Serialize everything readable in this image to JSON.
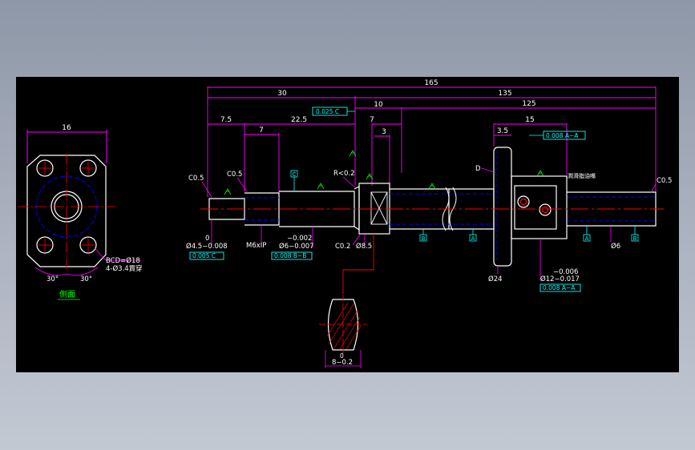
{
  "side_view": {
    "width_dim": "16",
    "bcd_note": "BCD=Ø18",
    "hole_note": "4-Ø3.4貫穿",
    "angle_left": "30°",
    "angle_right": "30°",
    "caption": "側面"
  },
  "overall": {
    "total_length": "165",
    "left_section": "30",
    "right_section": "135",
    "nut_to_end": "125",
    "flange_len": "15",
    "flange_offset": "3.5",
    "dim_7_5": "7.5",
    "dim_7_a": "7",
    "dim_22_5": "22.5",
    "dim_7_b": "7",
    "dim_3": "3",
    "dim_10": "10"
  },
  "chamfers": {
    "left_end": "C0.5",
    "step": "C0.5",
    "right_end": "C0.5",
    "groove": "C0.2",
    "radius": "R<0.2"
  },
  "tolerances": {
    "d45_upper": "0",
    "d45": "Ø4.5−0.008",
    "d45_frame": "0.005 C",
    "thread": "M6xIP",
    "d6_upper": "−0.002",
    "d6": "Ø6−0.007",
    "d6_frame": "0.008 B−B",
    "d85": "Ø8.5",
    "d24": "Ø24",
    "d12_upper": "−0.006",
    "d12": "Ø12−0.017",
    "d12_frame": "0.008 A−A",
    "d6_right": "Ø6",
    "top_frame": "0.025 C",
    "flange_frame": "0.008 A−A",
    "section_width": "8−0.2",
    "section_upper": "0"
  },
  "datums": {
    "c": "C",
    "b": "B",
    "a": "A",
    "d": "D"
  },
  "nut_note": "潤滑脂油嘴",
  "colors": {
    "background": "#000000",
    "dimension": "#ff00ff",
    "outline": "#ffffff",
    "hidden": "#0000ff",
    "center": "#ff0000",
    "text": "#00ff00",
    "frame": "#00ffff"
  }
}
